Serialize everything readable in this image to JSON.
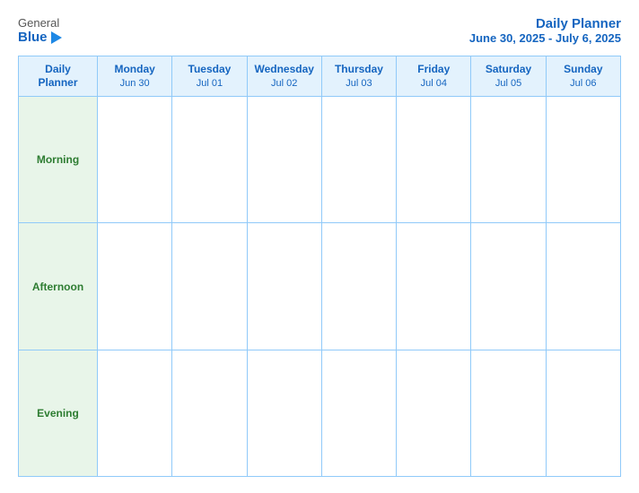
{
  "header": {
    "logo_general": "General",
    "logo_blue": "Blue",
    "title": "Daily Planner",
    "subtitle": "June 30, 2025 - July 6, 2025"
  },
  "table": {
    "header_label": "Daily\nPlanner",
    "days": [
      {
        "name": "Monday",
        "date": "Jun 30"
      },
      {
        "name": "Tuesday",
        "date": "Jul 01"
      },
      {
        "name": "Wednesday",
        "date": "Jul 02"
      },
      {
        "name": "Thursday",
        "date": "Jul 03"
      },
      {
        "name": "Friday",
        "date": "Jul 04"
      },
      {
        "name": "Saturday",
        "date": "Jul 05"
      },
      {
        "name": "Sunday",
        "date": "Jul 06"
      }
    ],
    "rows": [
      {
        "label": "Morning"
      },
      {
        "label": "Afternoon"
      },
      {
        "label": "Evening"
      }
    ]
  }
}
